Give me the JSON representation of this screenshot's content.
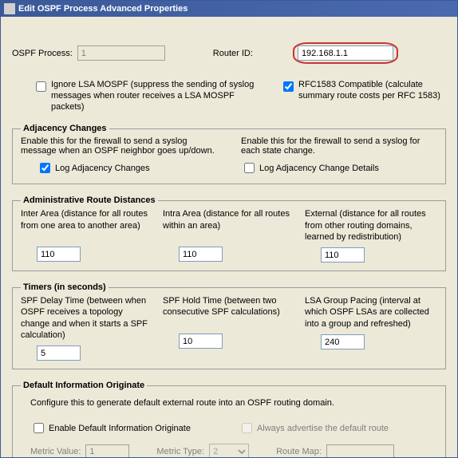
{
  "window_title": "Edit OSPF Process Advanced Properties",
  "top": {
    "ospf_process_label": "OSPF Process:",
    "ospf_process_value": "1",
    "router_id_label": "Router ID:",
    "router_id_value": "192.168.1.1"
  },
  "flags": {
    "ignore_mospf_checked": false,
    "ignore_mospf_text": "Ignore LSA MOSPF (suppress the sending of syslog messages when router receives a LSA MOSPF packets)",
    "rfc1583_checked": true,
    "rfc1583_text": "RFC1583 Compatible (calculate summary route costs per RFC 1583)"
  },
  "adjacency": {
    "legend": "Adjacency Changes",
    "left_desc": "Enable this for the firewall to send a syslog message when an OSPF neighbor goes up/down.",
    "left_cb_label": "Log Adjacency Changes",
    "left_cb_checked": true,
    "right_desc": "Enable this for the firewall to send a syslog for each state change.",
    "right_cb_label": "Log Adjacency Change Details",
    "right_cb_checked": false
  },
  "admin": {
    "legend": "Administrative Route Distances",
    "inter_desc": "Inter Area (distance for all routes from one area to another area)",
    "inter_value": "110",
    "intra_desc": "Intra Area (distance for all routes within an area)",
    "intra_value": "110",
    "external_desc": "External (distance for all routes from other routing domains, learned by redistribution)",
    "external_value": "110"
  },
  "timers": {
    "legend": "Timers (in seconds)",
    "spf_delay_desc": "SPF Delay Time (between when OSPF receives a topology change and when it starts a SPF calculation)",
    "spf_delay_value": "5",
    "spf_hold_desc": "SPF Hold Time (between two consecutive SPF calculations)",
    "spf_hold_value": "10",
    "lsa_group_desc": "LSA Group Pacing (interval at which OSPF LSAs are collected into a group and refreshed)",
    "lsa_group_value": "240"
  },
  "default_info": {
    "legend": "Default Information Originate",
    "config_text": "Configure this to generate default external route into an OSPF routing domain.",
    "enable_label": "Enable Default Information Originate",
    "enable_checked": false,
    "always_label": "Always advertise the default route",
    "always_checked": false,
    "metric_value_label": "Metric Value:",
    "metric_value": "1",
    "metric_type_label": "Metric Type:",
    "metric_type": "2",
    "route_map_label": "Route Map:",
    "route_map_value": ""
  }
}
